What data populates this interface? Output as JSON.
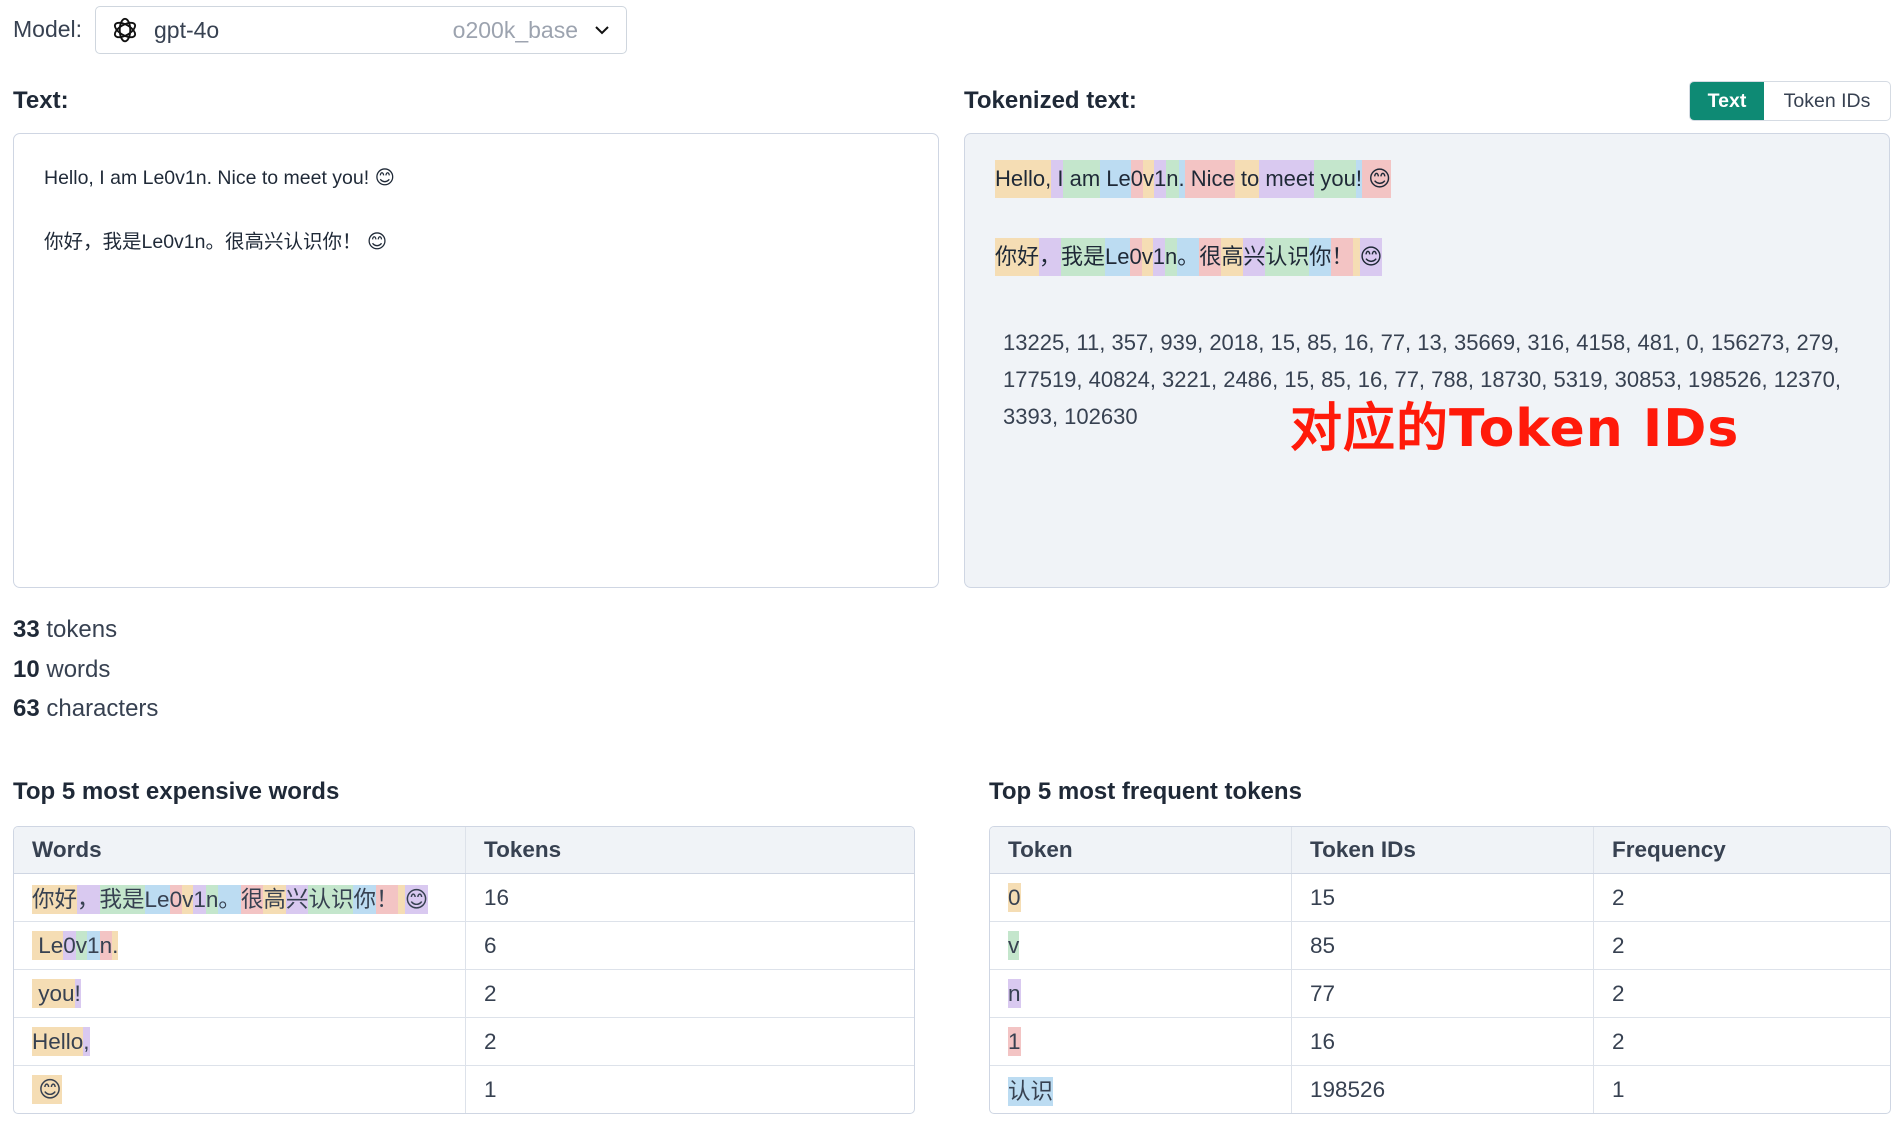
{
  "model": {
    "label": "Model:",
    "name": "gpt-4o",
    "encoding": "o200k_base",
    "logo_icon": "openai-logo-icon",
    "chevron_icon": "chevron-down-icon"
  },
  "input": {
    "title": "Text:",
    "lines": [
      "Hello, I am Le0v1n. Nice to meet you! 😊",
      "",
      "你好，我是Le0v1n。很高兴认识你！ 😊"
    ]
  },
  "output": {
    "title": "Tokenized text:",
    "toggle": {
      "text": "Text",
      "ids": "Token IDs",
      "active": "Text",
      "active_color": "#0e8a74"
    },
    "token_lines": [
      [
        "Hello,",
        " I",
        " am",
        " Le",
        "0",
        "v",
        "1",
        "n",
        ".",
        " Nice",
        " to",
        " meet",
        " you",
        "!",
        " 😊"
      ],
      [
        "你好",
        "，",
        "我是",
        "Le",
        "0",
        "v",
        "1",
        "n",
        "。",
        "很",
        "高",
        "兴",
        "认识",
        "你",
        "！",
        " ",
        "😊"
      ]
    ],
    "token_ids_text": "13225, 11, 357, 939, 2018, 15, 85, 16, 77, 13, 35669, 316, 4158, 481, 0, 156273, 279, 177519, 40824, 3221, 2486, 15, 85, 16, 77, 788, 18730, 5319, 30853, 198526, 12370, 3393, 102630",
    "annotation": "对应的Token IDs",
    "annotation_color": "#ff1a0a"
  },
  "stats": {
    "tokens_count": "33",
    "tokens_label": " tokens",
    "words_count": "10",
    "words_label": " words",
    "chars_count": "63",
    "chars_label": " characters"
  },
  "expensive": {
    "title": "Top 5 most expensive words",
    "headers": [
      "Words",
      "Tokens"
    ],
    "rows": [
      {
        "tokens": [
          "你好",
          "，",
          "我是",
          "Le",
          "0",
          "v",
          "1",
          "n",
          "。",
          "很",
          "高",
          "兴",
          "认识",
          "你",
          "！",
          " ",
          "😊"
        ],
        "count": "16"
      },
      {
        "tokens": [
          " Le",
          "0",
          "v",
          "1",
          "n",
          "."
        ],
        "count": "6"
      },
      {
        "tokens": [
          " you",
          "!"
        ],
        "count": "2"
      },
      {
        "tokens": [
          "Hello",
          ","
        ],
        "count": "2"
      },
      {
        "tokens": [
          " 😊"
        ],
        "count": "1"
      }
    ]
  },
  "frequent": {
    "title": "Top 5 most frequent tokens",
    "headers": [
      "Token",
      "Token IDs",
      "Frequency"
    ],
    "rows": [
      {
        "token": "0",
        "id": "15",
        "freq": "2"
      },
      {
        "token": "v",
        "id": "85",
        "freq": "2"
      },
      {
        "token": "n",
        "id": "77",
        "freq": "2"
      },
      {
        "token": "1",
        "id": "16",
        "freq": "2"
      },
      {
        "token": "认识",
        "id": "198526",
        "freq": "1"
      }
    ]
  },
  "token_palette": [
    "#f5ddb4",
    "#d9c9f0",
    "#c4e6cc",
    "#bcdcf2",
    "#f3c4c4"
  ]
}
